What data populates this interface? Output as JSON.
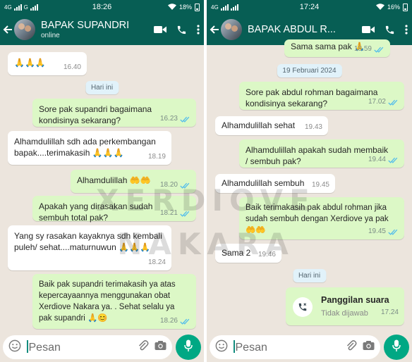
{
  "left": {
    "status": {
      "network": "4G",
      "network2": "G",
      "time": "18:26",
      "battery": "18%"
    },
    "header": {
      "name": "BAPAK SUPANDRI",
      "subtitle": "online"
    },
    "messages": [
      {
        "dir": "in",
        "text": "🙏🙏🙏",
        "time": "16.40"
      },
      {
        "dir": "date",
        "text": "Hari ini"
      },
      {
        "dir": "out",
        "text": "Sore pak supandri bagaimana kondisinya sekarang?",
        "time": "16.23"
      },
      {
        "dir": "in",
        "text": "Alhamdulillah sdh ada perkembangan bapak....terimakasih 🙏🙏🙏",
        "time": "18.19"
      },
      {
        "dir": "out",
        "text": "Alhamdulillah 🤲🤲",
        "time": "18.20"
      },
      {
        "dir": "out",
        "text": "Apakah yang dirasakan sudah sembuh total pak?",
        "time": "18.21"
      },
      {
        "dir": "in",
        "text": "Yang sy rasakan kayaknya sdh kembali puleh/ sehat....maturnuwun 🙏🙏🙏",
        "time": "18.24"
      },
      {
        "dir": "out",
        "text": "Baik pak supandri terimakasih ya atas kepercayaannya menggunakan obat Xerdiove Nakara ya. .  Sehat selalu ya pak supandri 🙏😊",
        "time": "18.26"
      }
    ],
    "input": {
      "placeholder": "Pesan"
    }
  },
  "right": {
    "status": {
      "network": "4G",
      "time": "17:24",
      "battery": "16%"
    },
    "header": {
      "name": "BAPAK ABDUL R..."
    },
    "messages": [
      {
        "dir": "out",
        "text": "Sama sama pak 🙏",
        "time": "18.59"
      },
      {
        "dir": "date",
        "text": "19 Februari 2024"
      },
      {
        "dir": "out",
        "text": "Sore pak abdul rohman bagaimana kondisinya sekarang?",
        "time": "17.02"
      },
      {
        "dir": "in",
        "text": "Alhamdulillah sehat",
        "time": "19.43"
      },
      {
        "dir": "out",
        "text": "Alhamdulillah apakah sudah membaik / sembuh pak?",
        "time": "19.44"
      },
      {
        "dir": "in",
        "text": "Alhamdulillah sembuh",
        "time": "19.45"
      },
      {
        "dir": "out",
        "text": "Baik terimakasih pak abdul rohman jika sudah sembuh dengan Xerdiove  ya pak 🤲🤲",
        "time": "19.45"
      },
      {
        "dir": "in",
        "text": "Sama 2",
        "time": "19.46"
      },
      {
        "dir": "date",
        "text": "Hari ini"
      },
      {
        "dir": "call",
        "title": "Panggilan suara",
        "subtitle": "Tidak dijawab",
        "time": "17.24"
      }
    ],
    "input": {
      "placeholder": "Pesan"
    }
  },
  "watermark": {
    "line1": "XERDIOVE",
    "line2": "NAKARA"
  },
  "colors": {
    "header": "#075e54",
    "outgoing": "#dcf8c6",
    "incoming": "#ffffff",
    "background": "#ece5dd",
    "mic": "#00a884",
    "tick": "#53bdeb"
  }
}
